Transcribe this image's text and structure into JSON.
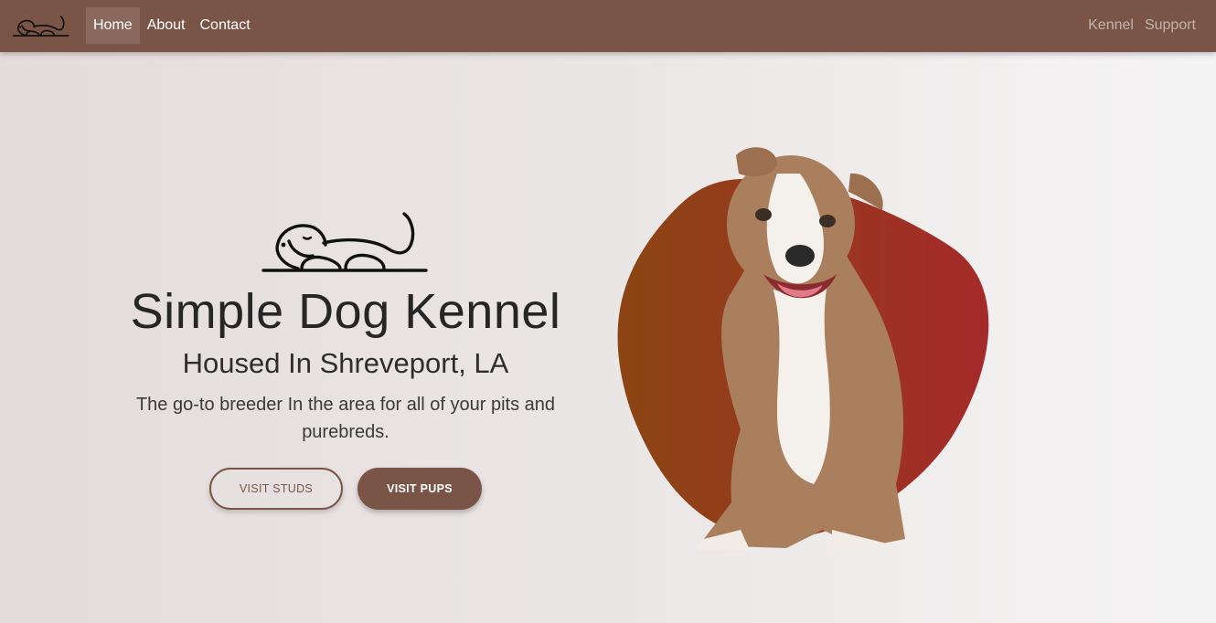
{
  "navbar": {
    "brand_icon": "sleeping-dog-icon",
    "left_links": [
      "Home",
      "About",
      "Contact"
    ],
    "right_links": [
      "Kennel",
      "Support"
    ],
    "active": "Home",
    "color": "#7a5447"
  },
  "hero": {
    "logo_icon": "sleeping-dog-icon",
    "title": "Simple Dog Kennel",
    "subtitle": "Housed In Shreveport, LA",
    "description": "The go-to breeder In the area for all of your pits and purebreds.",
    "buttons": {
      "studs": "VISIT STUDS",
      "pups": "VISIT PUPS"
    },
    "image": "pitbull-puppy-photo",
    "blob_gradient": [
      "#8b4513",
      "#a52a2a"
    ]
  }
}
